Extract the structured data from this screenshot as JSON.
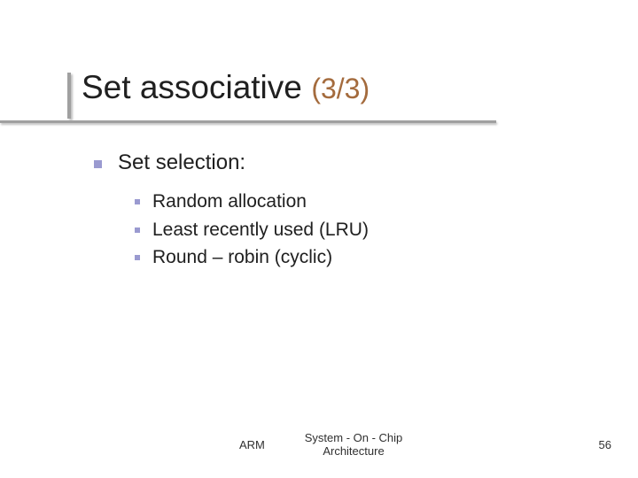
{
  "title": {
    "main": "Set associative",
    "count": "(3/3)"
  },
  "heading": "Set selection:",
  "items": [
    "Random allocation",
    "Least recently used (LRU)",
    "Round – robin (cyclic)"
  ],
  "footer": {
    "left": "ARM",
    "mid_line1": "System - On - Chip",
    "mid_line2": "Architecture",
    "page": "56"
  }
}
